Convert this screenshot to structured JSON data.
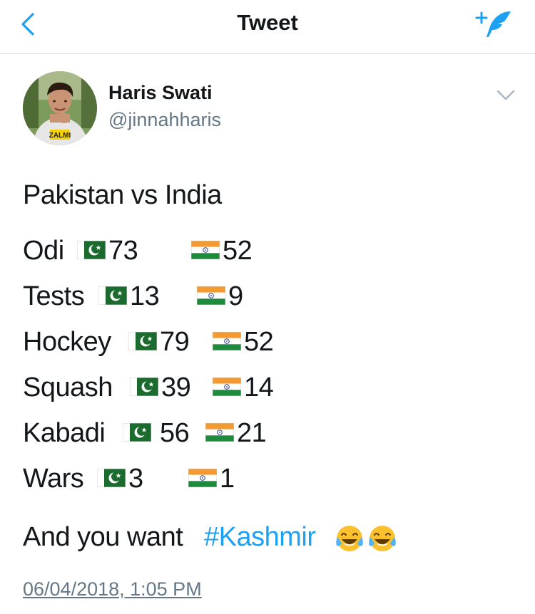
{
  "header": {
    "title": "Tweet"
  },
  "user": {
    "name": "Haris Swati",
    "handle": "@jinnahharis",
    "avatar_text": "ZALMI"
  },
  "tweet": {
    "heading": "Pakistan vs India",
    "stats": [
      {
        "sport": "Odi",
        "pakistan": "73",
        "india": "52"
      },
      {
        "sport": "Tests",
        "pakistan": "13",
        "india": "9"
      },
      {
        "sport": "Hockey",
        "pakistan": "79",
        "india": "52"
      },
      {
        "sport": "Squash",
        "pakistan": "39",
        "india": "14"
      },
      {
        "sport": "Kabadi",
        "pakistan": "56",
        "india": "21"
      },
      {
        "sport": "Wars",
        "pakistan": "3",
        "india": "1"
      }
    ],
    "closing_text": "And you want ",
    "hashtag": "#Kashmir",
    "timestamp": "06/04/2018, 1:05 PM"
  },
  "icons": {
    "back": "chevron-left-icon",
    "compose": "compose-tweet-icon",
    "caret": "chevron-down-icon",
    "flag_pk": "pakistan-flag-icon",
    "flag_in": "india-flag-icon",
    "laugh": "tears-of-joy-emoji"
  },
  "colors": {
    "accent": "#1da1f2",
    "text": "#14171a",
    "secondary": "#657786",
    "divider": "#d9d9d9"
  }
}
